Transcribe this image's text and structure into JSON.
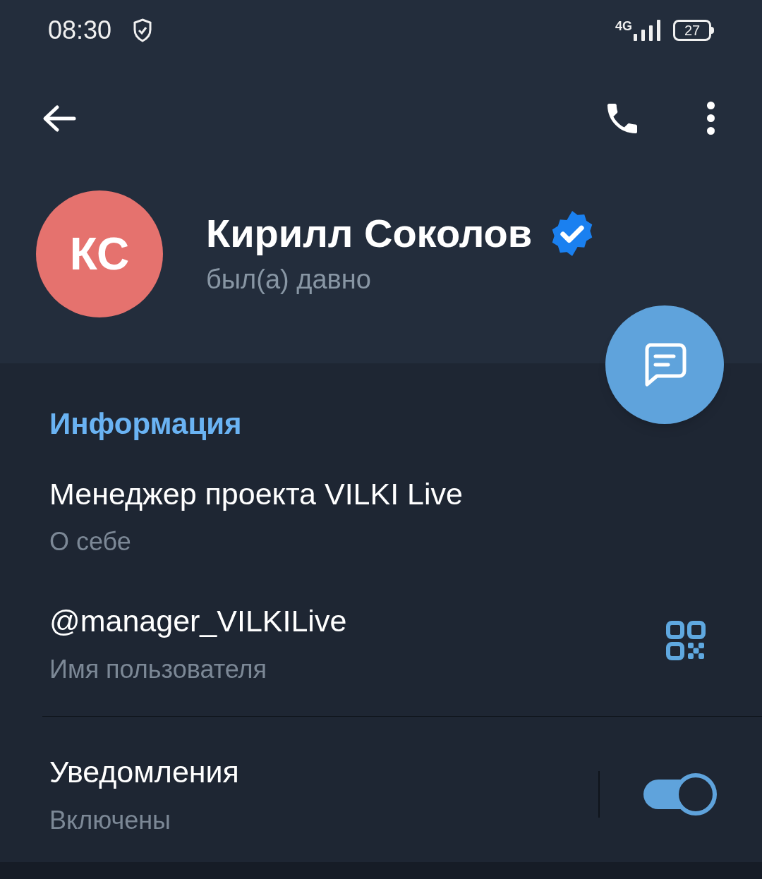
{
  "status_bar": {
    "time": "08:30",
    "network": "4G",
    "battery": "27"
  },
  "profile": {
    "initials": "КС",
    "name": "Кирилл Соколов",
    "verified": true,
    "last_seen": "был(а) давно"
  },
  "info": {
    "header": "Информация",
    "items": [
      {
        "kind": "text",
        "value": "Менеджер проекта VILKI Live",
        "label": "О себе"
      },
      {
        "kind": "username",
        "value": "@manager_VILKILive",
        "label": "Имя пользователя"
      },
      {
        "kind": "toggle",
        "value": "Уведомления",
        "label": "Включены",
        "on": true
      }
    ]
  }
}
